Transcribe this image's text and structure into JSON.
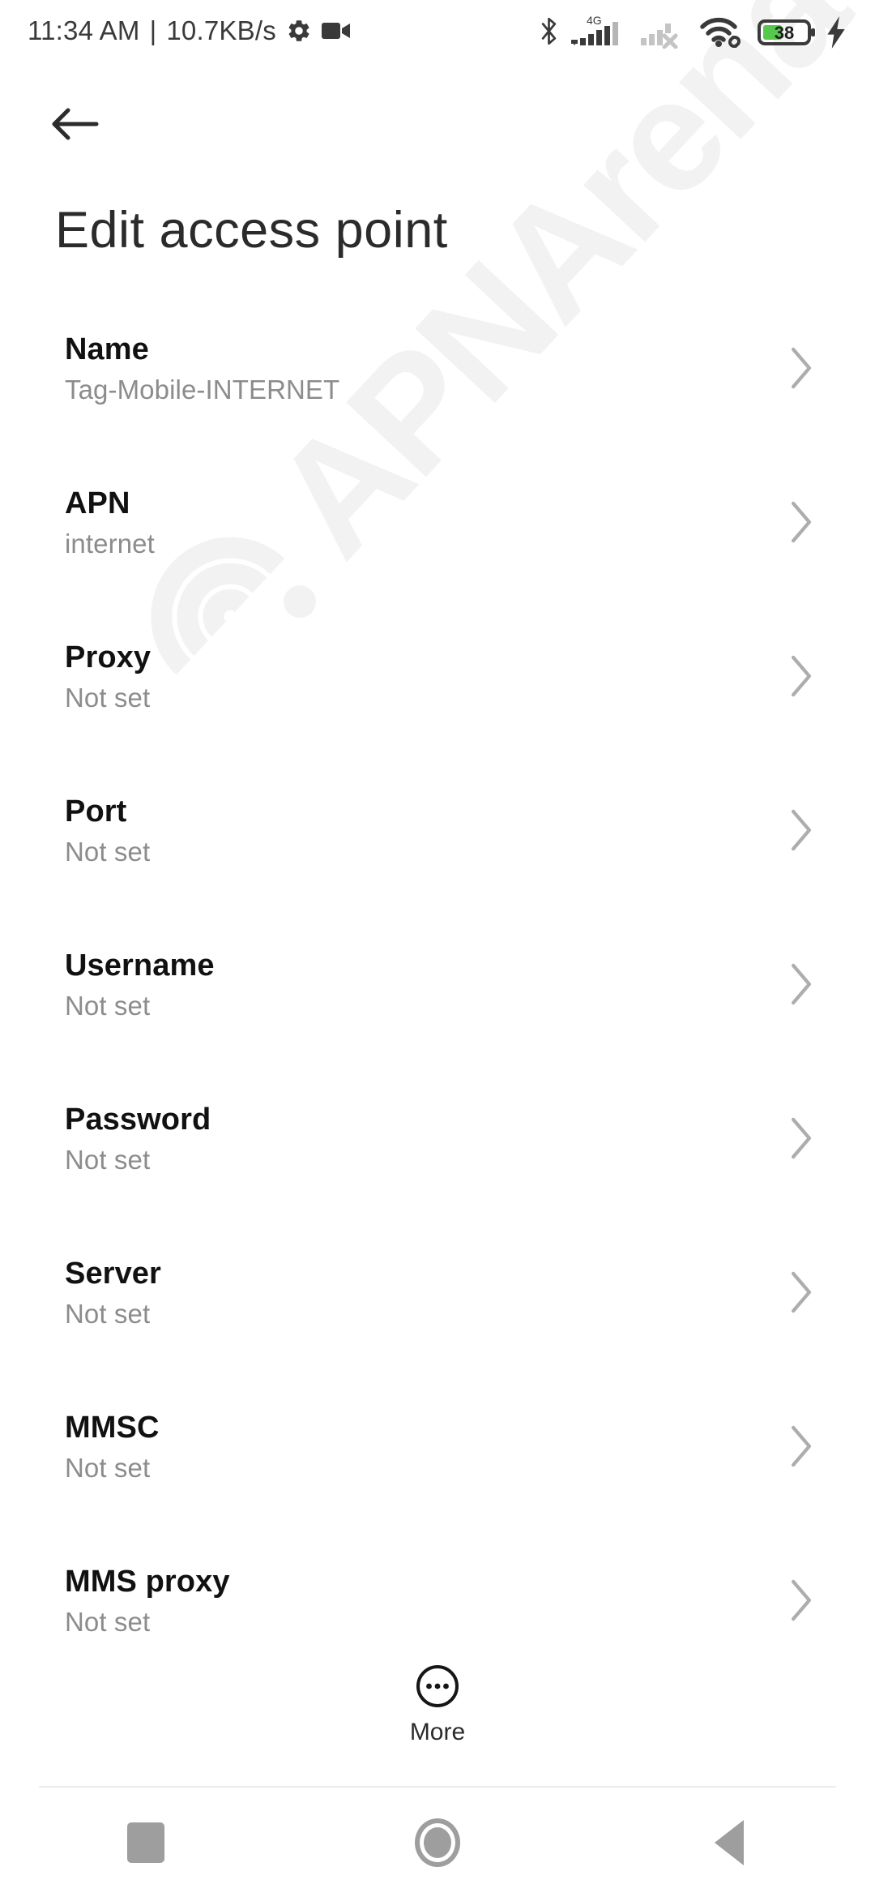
{
  "status_bar": {
    "time": "11:34 AM",
    "separator": "|",
    "network_speed": "10.7KB/s",
    "icons": [
      "gear-icon",
      "video-camera-icon"
    ],
    "right_icons": [
      "bluetooth-icon",
      "signal-4g-icon",
      "sim2-no-signal-icon",
      "wifi-link-icon",
      "battery-icon",
      "charging-bolt-icon"
    ],
    "network_type": "4G",
    "battery_percent": "38",
    "battery_color": "#57c84d"
  },
  "header": {
    "back_icon": "arrow-left-icon",
    "title": "Edit access point"
  },
  "watermark": {
    "text": "APNArena",
    "color": "#f2f2f2",
    "icon": "wifi-icon"
  },
  "list": {
    "chevron_icon": "chevron-right-icon",
    "rows": [
      {
        "label": "Name",
        "value": "Tag-Mobile-INTERNET"
      },
      {
        "label": "APN",
        "value": "internet"
      },
      {
        "label": "Proxy",
        "value": "Not set"
      },
      {
        "label": "Port",
        "value": "Not set"
      },
      {
        "label": "Username",
        "value": "Not set"
      },
      {
        "label": "Password",
        "value": "Not set"
      },
      {
        "label": "Server",
        "value": "Not set"
      },
      {
        "label": "MMSC",
        "value": "Not set"
      },
      {
        "label": "MMS proxy",
        "value": "Not set"
      }
    ]
  },
  "more_button": {
    "label": "More",
    "icon": "more-circle-icon"
  },
  "navigation_bar": {
    "recents_icon": "square-icon",
    "home_icon": "circle-icon",
    "back_icon": "triangle-left-icon"
  }
}
